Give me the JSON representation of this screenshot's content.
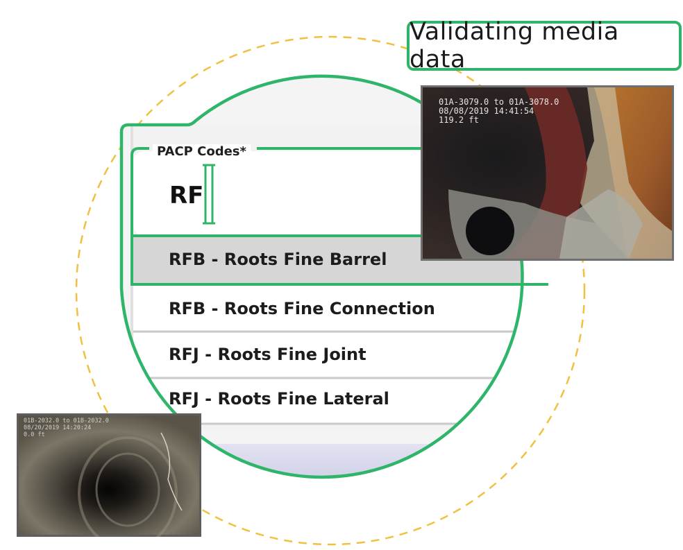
{
  "status": {
    "text": "Validating media data"
  },
  "field": {
    "label": "PACP Codes*",
    "value": "RF"
  },
  "suggestions": [
    {
      "label": "RFB - Roots Fine Barrel",
      "highlighted": true
    },
    {
      "label": "RFB - Roots Fine Connection",
      "highlighted": false
    },
    {
      "label": "RFJ - Roots Fine Joint",
      "highlighted": false
    },
    {
      "label": "RFJ - Roots Fine Lateral",
      "highlighted": false
    }
  ],
  "media": {
    "main_overlay": [
      "01A-3079.0 to 01A-3078.0",
      "08/08/2019 14:41:54",
      "119.2 ft"
    ],
    "thumb_overlay": [
      "01B-2032.0 to 01B-2032.0",
      "08/20/2019 14:20:24",
      "0.0 ft"
    ]
  },
  "colors": {
    "accent": "#2fb56a",
    "dashed_ring": "#f0c040",
    "highlight_row": "#d6d6d6"
  }
}
